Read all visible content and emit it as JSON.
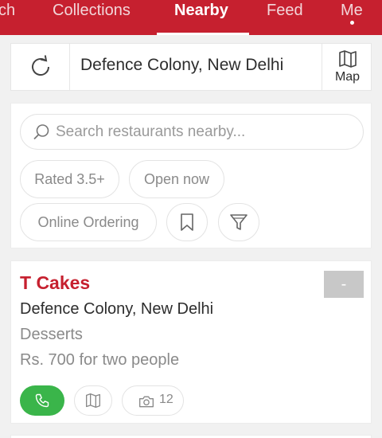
{
  "tabs": [
    {
      "label": "ch",
      "active": false
    },
    {
      "label": "Collections",
      "active": false
    },
    {
      "label": "Nearby",
      "active": true
    },
    {
      "label": "Feed",
      "active": false
    },
    {
      "label": "Me",
      "active": false
    }
  ],
  "location_bar": {
    "refresh_icon": "refresh-icon",
    "location": "Defence Colony, New Delhi",
    "map_label": "Map",
    "map_icon": "map-icon"
  },
  "filters": {
    "search_placeholder": "Search restaurants nearby...",
    "chips": [
      "Rated 3.5+",
      "Open now",
      "Online Ordering"
    ],
    "bookmark_icon": "bookmark-icon",
    "filter_icon": "filter-icon"
  },
  "restaurant": {
    "name": "T Cakes",
    "rating": "-",
    "location": "Defence Colony, New Delhi",
    "cuisine": "Desserts",
    "cost": "Rs. 700 for two people",
    "photo_count": "12"
  },
  "colors": {
    "brand": "#c6202f",
    "call_green": "#3ab54a",
    "badge_grey": "#c8c8c8"
  }
}
